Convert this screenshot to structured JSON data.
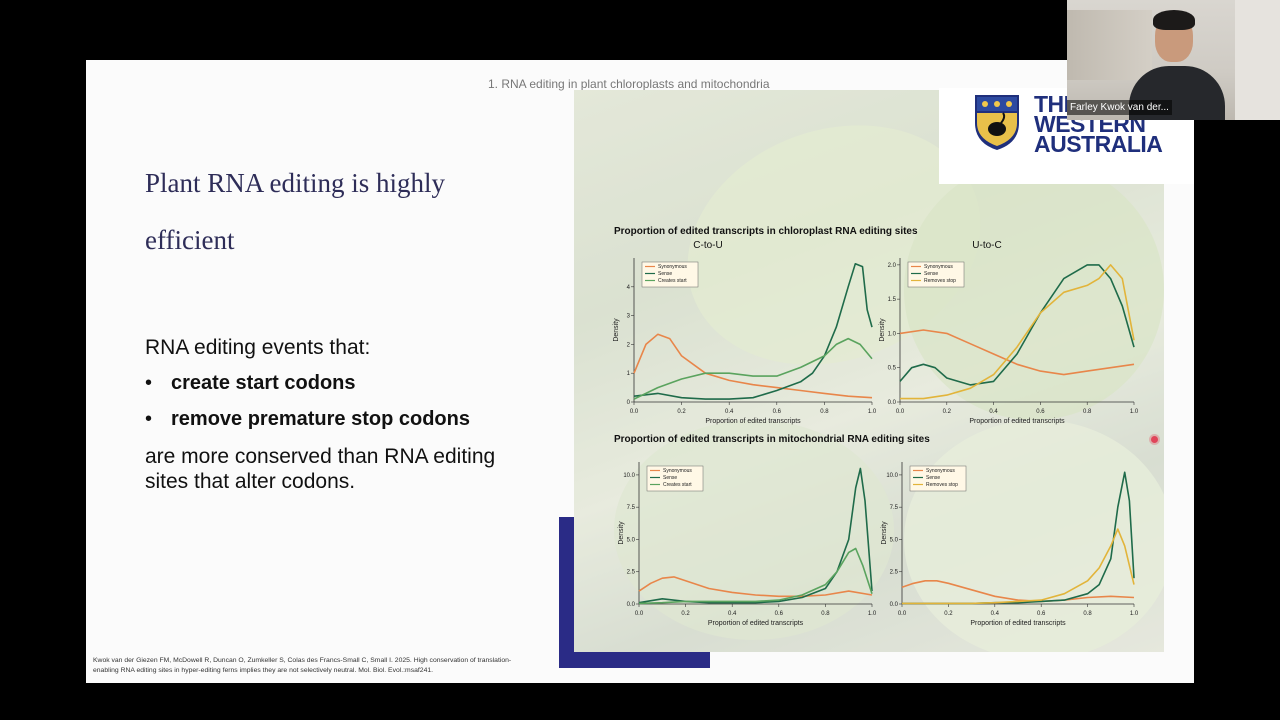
{
  "slide": {
    "header": "1. RNA editing in plant chloroplasts and mitochondria",
    "title": "Plant RNA editing is highly efficient",
    "body_lead": "RNA editing events that:",
    "bullets": [
      "create start codons",
      "remove premature stop codons"
    ],
    "body_tail": "are more conserved than RNA editing sites that alter codons.",
    "citation": "Kwok van der Giezen FM, McDowell R, Duncan O, Zumkeller S, Colas des Francs-Small C, Small I. 2025. High conservation of translation-enabling RNA editing sites in hyper-editing ferns implies they are not selectively neutral. Mol. Biol. Evol.:msaf241.",
    "logo": {
      "line1": "THE",
      "line2": "WESTERN",
      "line3": "AUSTRALIA"
    }
  },
  "colors": {
    "title": "#2e2d58",
    "accent_bar": "#2a2b86",
    "synonymous": "#e8864a",
    "sense": "#1f6b4a",
    "creates_start": "#5aa35e",
    "removes_stop": "#e2b43a"
  },
  "video": {
    "participant_name": "Farley Kwok van der..."
  },
  "chart_data": [
    {
      "type": "line",
      "section_title": "Proportion of edited transcripts in chloroplast RNA editing sites",
      "title": "C-to-U",
      "xlabel": "Proportion of edited transcripts",
      "ylabel": "Density",
      "xlim": [
        0,
        1
      ],
      "ylim": [
        0,
        5
      ],
      "xticks": [
        "0.0",
        "0.2",
        "0.4",
        "0.6",
        "0.8",
        "1.0"
      ],
      "yticks": [
        "0",
        "1",
        "2",
        "3",
        "4"
      ],
      "legend": "top-left",
      "series": [
        {
          "name": "Synonymous",
          "color": "#e8864a",
          "x": [
            0,
            0.05,
            0.1,
            0.15,
            0.2,
            0.3,
            0.4,
            0.5,
            0.6,
            0.7,
            0.8,
            0.9,
            1.0
          ],
          "y": [
            1.0,
            2.0,
            2.35,
            2.2,
            1.6,
            1.0,
            0.75,
            0.6,
            0.5,
            0.4,
            0.3,
            0.2,
            0.15
          ]
        },
        {
          "name": "Sense",
          "color": "#1f6b4a",
          "x": [
            0,
            0.1,
            0.2,
            0.3,
            0.4,
            0.5,
            0.6,
            0.7,
            0.75,
            0.8,
            0.85,
            0.9,
            0.93,
            0.96,
            0.98,
            1.0
          ],
          "y": [
            0.2,
            0.3,
            0.15,
            0.1,
            0.1,
            0.15,
            0.4,
            0.7,
            1.0,
            1.6,
            2.6,
            4.0,
            4.8,
            4.7,
            3.2,
            2.6
          ]
        },
        {
          "name": "Creates start",
          "color": "#5aa35e",
          "x": [
            0,
            0.1,
            0.2,
            0.3,
            0.4,
            0.5,
            0.6,
            0.7,
            0.8,
            0.85,
            0.9,
            0.95,
            1.0
          ],
          "y": [
            0.1,
            0.5,
            0.8,
            1.0,
            1.0,
            0.9,
            0.9,
            1.2,
            1.6,
            2.0,
            2.2,
            2.0,
            1.5
          ]
        }
      ]
    },
    {
      "type": "line",
      "title": "U-to-C",
      "xlabel": "Proportion of edited transcripts",
      "ylabel": "Density",
      "xlim": [
        0,
        1
      ],
      "ylim": [
        0,
        2.1
      ],
      "xticks": [
        "0.0",
        "0.2",
        "0.4",
        "0.6",
        "0.8",
        "1.0"
      ],
      "yticks": [
        "0.0",
        "0.5",
        "1.0",
        "1.5",
        "2.0"
      ],
      "legend": "top-left",
      "series": [
        {
          "name": "Synonymous",
          "color": "#e8864a",
          "x": [
            0,
            0.1,
            0.2,
            0.3,
            0.4,
            0.5,
            0.6,
            0.7,
            0.8,
            0.9,
            1.0
          ],
          "y": [
            1.0,
            1.05,
            1.0,
            0.85,
            0.7,
            0.55,
            0.45,
            0.4,
            0.45,
            0.5,
            0.55
          ]
        },
        {
          "name": "Sense",
          "color": "#1f6b4a",
          "x": [
            0,
            0.05,
            0.1,
            0.15,
            0.2,
            0.3,
            0.4,
            0.5,
            0.6,
            0.7,
            0.8,
            0.85,
            0.9,
            0.95,
            1.0
          ],
          "y": [
            0.3,
            0.5,
            0.55,
            0.5,
            0.35,
            0.25,
            0.3,
            0.7,
            1.3,
            1.8,
            2.0,
            2.0,
            1.8,
            1.4,
            0.8
          ]
        },
        {
          "name": "Removes stop",
          "color": "#e2b43a",
          "x": [
            0,
            0.1,
            0.2,
            0.3,
            0.4,
            0.5,
            0.6,
            0.7,
            0.8,
            0.85,
            0.9,
            0.95,
            1.0
          ],
          "y": [
            0.05,
            0.05,
            0.1,
            0.2,
            0.4,
            0.8,
            1.3,
            1.6,
            1.7,
            1.8,
            2.0,
            1.8,
            0.9
          ]
        }
      ]
    },
    {
      "type": "line",
      "section_title": "Proportion of edited transcripts in mitochondrial RNA editing sites",
      "title": "",
      "xlabel": "Proportion of edited transcripts",
      "ylabel": "Density",
      "xlim": [
        0,
        1
      ],
      "ylim": [
        0,
        11
      ],
      "xticks": [
        "0.0",
        "0.2",
        "0.4",
        "0.6",
        "0.8",
        "1.0"
      ],
      "yticks": [
        "0.0",
        "2.5",
        "5.0",
        "7.5",
        "10.0"
      ],
      "legend": "top-left",
      "series": [
        {
          "name": "Synonymous",
          "color": "#e8864a",
          "x": [
            0,
            0.05,
            0.1,
            0.15,
            0.2,
            0.3,
            0.4,
            0.5,
            0.6,
            0.7,
            0.8,
            0.9,
            1.0
          ],
          "y": [
            1.0,
            1.6,
            2.0,
            2.1,
            1.8,
            1.2,
            0.9,
            0.7,
            0.6,
            0.6,
            0.7,
            1.0,
            0.7
          ]
        },
        {
          "name": "Sense",
          "color": "#1f6b4a",
          "x": [
            0,
            0.1,
            0.2,
            0.3,
            0.4,
            0.5,
            0.6,
            0.7,
            0.8,
            0.85,
            0.9,
            0.93,
            0.95,
            0.97,
            1.0
          ],
          "y": [
            0.1,
            0.4,
            0.2,
            0.1,
            0.1,
            0.1,
            0.2,
            0.5,
            1.2,
            2.5,
            5.0,
            9.0,
            10.5,
            8.0,
            1.0
          ]
        },
        {
          "name": "Creates start",
          "color": "#5aa35e",
          "x": [
            0,
            0.1,
            0.2,
            0.3,
            0.4,
            0.5,
            0.6,
            0.7,
            0.8,
            0.85,
            0.9,
            0.93,
            0.96,
            1.0
          ],
          "y": [
            0.05,
            0.1,
            0.2,
            0.2,
            0.2,
            0.2,
            0.3,
            0.7,
            1.5,
            2.5,
            4.0,
            4.3,
            3.0,
            0.8
          ]
        }
      ]
    },
    {
      "type": "line",
      "title": "",
      "xlabel": "Proportion of edited transcripts",
      "ylabel": "Density",
      "xlim": [
        0,
        1
      ],
      "ylim": [
        0,
        11
      ],
      "xticks": [
        "0.0",
        "0.2",
        "0.4",
        "0.6",
        "0.8",
        "1.0"
      ],
      "yticks": [
        "0.0",
        "2.5",
        "5.0",
        "7.5",
        "10.0"
      ],
      "legend": "top-left",
      "series": [
        {
          "name": "Synonymous",
          "color": "#e8864a",
          "x": [
            0,
            0.05,
            0.1,
            0.15,
            0.2,
            0.3,
            0.4,
            0.5,
            0.6,
            0.7,
            0.8,
            0.9,
            1.0
          ],
          "y": [
            1.3,
            1.6,
            1.8,
            1.8,
            1.6,
            1.1,
            0.6,
            0.3,
            0.2,
            0.3,
            0.5,
            0.6,
            0.5
          ]
        },
        {
          "name": "Sense",
          "color": "#1f6b4a",
          "x": [
            0,
            0.1,
            0.2,
            0.3,
            0.4,
            0.5,
            0.6,
            0.7,
            0.8,
            0.85,
            0.9,
            0.93,
            0.96,
            0.98,
            1.0
          ],
          "y": [
            0.05,
            0.05,
            0.05,
            0.05,
            0.1,
            0.1,
            0.2,
            0.3,
            0.8,
            1.5,
            3.5,
            7.5,
            10.2,
            8.0,
            2.0
          ]
        },
        {
          "name": "Removes stop",
          "color": "#e2b43a",
          "x": [
            0,
            0.1,
            0.2,
            0.3,
            0.4,
            0.5,
            0.6,
            0.7,
            0.8,
            0.85,
            0.9,
            0.93,
            0.96,
            1.0
          ],
          "y": [
            0.05,
            0.05,
            0.05,
            0.05,
            0.1,
            0.2,
            0.3,
            0.8,
            1.8,
            2.8,
            4.5,
            5.8,
            4.5,
            1.5
          ]
        }
      ]
    }
  ]
}
